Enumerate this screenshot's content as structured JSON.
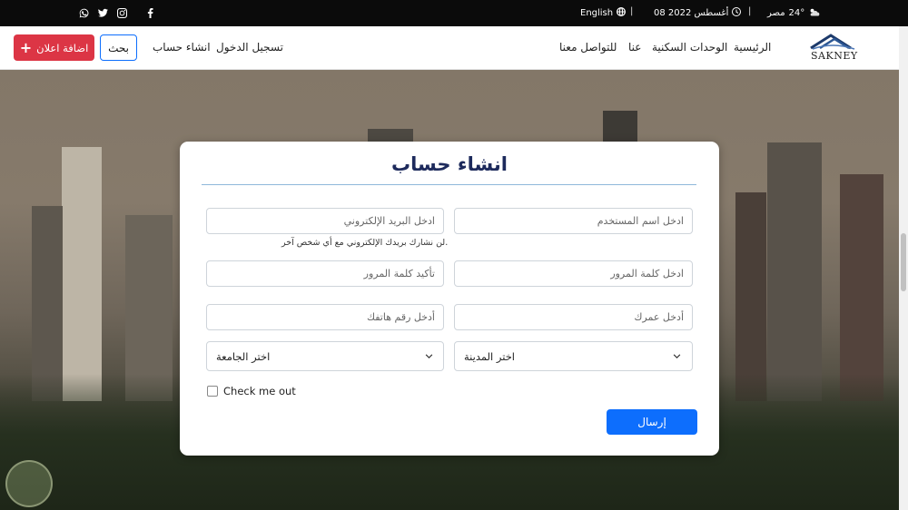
{
  "topbar": {
    "weather_temp": "24°",
    "weather_location": "مصر",
    "date": "08 أغسطس 2022",
    "language": "English",
    "separator": "|"
  },
  "navbar": {
    "add_listing_label": "اضافة اعلان",
    "search_label": "بحث",
    "create_account_label": "انشاء حساب",
    "login_label": "تسجيل الدخول",
    "links": [
      "الرئيسية",
      "الوحدات السكنية",
      "عنا",
      "للتواصل معنا"
    ],
    "logo_text": "SAKNEY"
  },
  "form": {
    "title": "انشاء حساب",
    "username_placeholder": "ادخل اسم المستخدم",
    "email_placeholder": "ادخل البريد الإلكتروني",
    "email_help": "لن نشارك بريدك الإلكتروني مع أي شخص آخر.",
    "password_placeholder": "ادخل كلمة المرور",
    "confirm_password_placeholder": "تأكيد كلمة المرور",
    "age_placeholder": "أدخل عمرك",
    "phone_placeholder": "أدخل رقم هاتفك",
    "city_select": "اختر المدينة",
    "university_select": "اختر الجامعة",
    "checkbox_label": "Check me out",
    "submit_label": "إرسال"
  },
  "colors": {
    "primary": "#0d6efd",
    "danger": "#dc3545",
    "title": "#1d2a5c"
  },
  "icons": [
    "whatsapp-icon",
    "twitter-icon",
    "instagram-icon",
    "facebook-icon",
    "globe-icon",
    "clock-icon",
    "weather-icon",
    "chevron-down-icon"
  ]
}
